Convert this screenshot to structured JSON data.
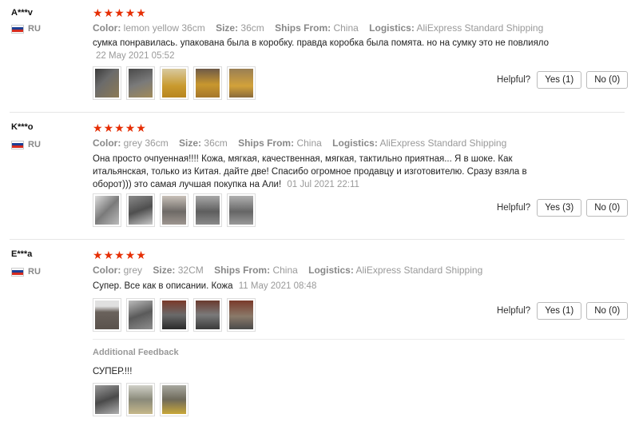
{
  "labels": {
    "color": "Color:",
    "size": "Size:",
    "ships_from": "Ships From:",
    "logistics": "Logistics:",
    "helpful": "Helpful?",
    "additional_feedback": "Additional Feedback"
  },
  "icons": {
    "star": "star-icon",
    "flag": "flag-ru-icon"
  },
  "colors": {
    "star": "#e62e04"
  },
  "reviews": [
    {
      "user": "A***v",
      "country": "RU",
      "rating": 5,
      "color": "lemon yellow 36cm",
      "size": "36cm",
      "ships_from": "China",
      "logistics": "AliExpress Standard Shipping",
      "text": "сумка понравилась. упакована была в коробку. правда коробка была помята. но на сумку это не повлияло",
      "date": "22 May 2021 05:52",
      "yes": "Yes (1)",
      "no": "No (0)",
      "photos": 5
    },
    {
      "user": "K***o",
      "country": "RU",
      "rating": 5,
      "color": "grey 36cm",
      "size": "36cm",
      "ships_from": "China",
      "logistics": "AliExpress Standard Shipping",
      "text": "Она просто очпуенная!!!! Кожа, мягкая, качественная, мягкая, тактильно приятная... Я в шоке. Как итальянская, только из Китая. дайте две! Спасибо огромное продавцу и изготовителю. Сразу взяла в оборот))) это самая лучшая покупка на Али!",
      "date": "01 Jul 2021 22:11",
      "yes": "Yes (3)",
      "no": "No (0)",
      "photos": 5
    },
    {
      "user": "E***a",
      "country": "RU",
      "rating": 5,
      "color": "grey",
      "size": "32CM",
      "ships_from": "China",
      "logistics": "AliExpress Standard Shipping",
      "text": "Супер. Все как в описании. Кожа",
      "date": "11 May 2021 08:48",
      "yes": "Yes (1)",
      "no": "No (0)",
      "photos": 5,
      "additional_text": "СУПЕР.!!!",
      "additional_photos": 3
    }
  ]
}
